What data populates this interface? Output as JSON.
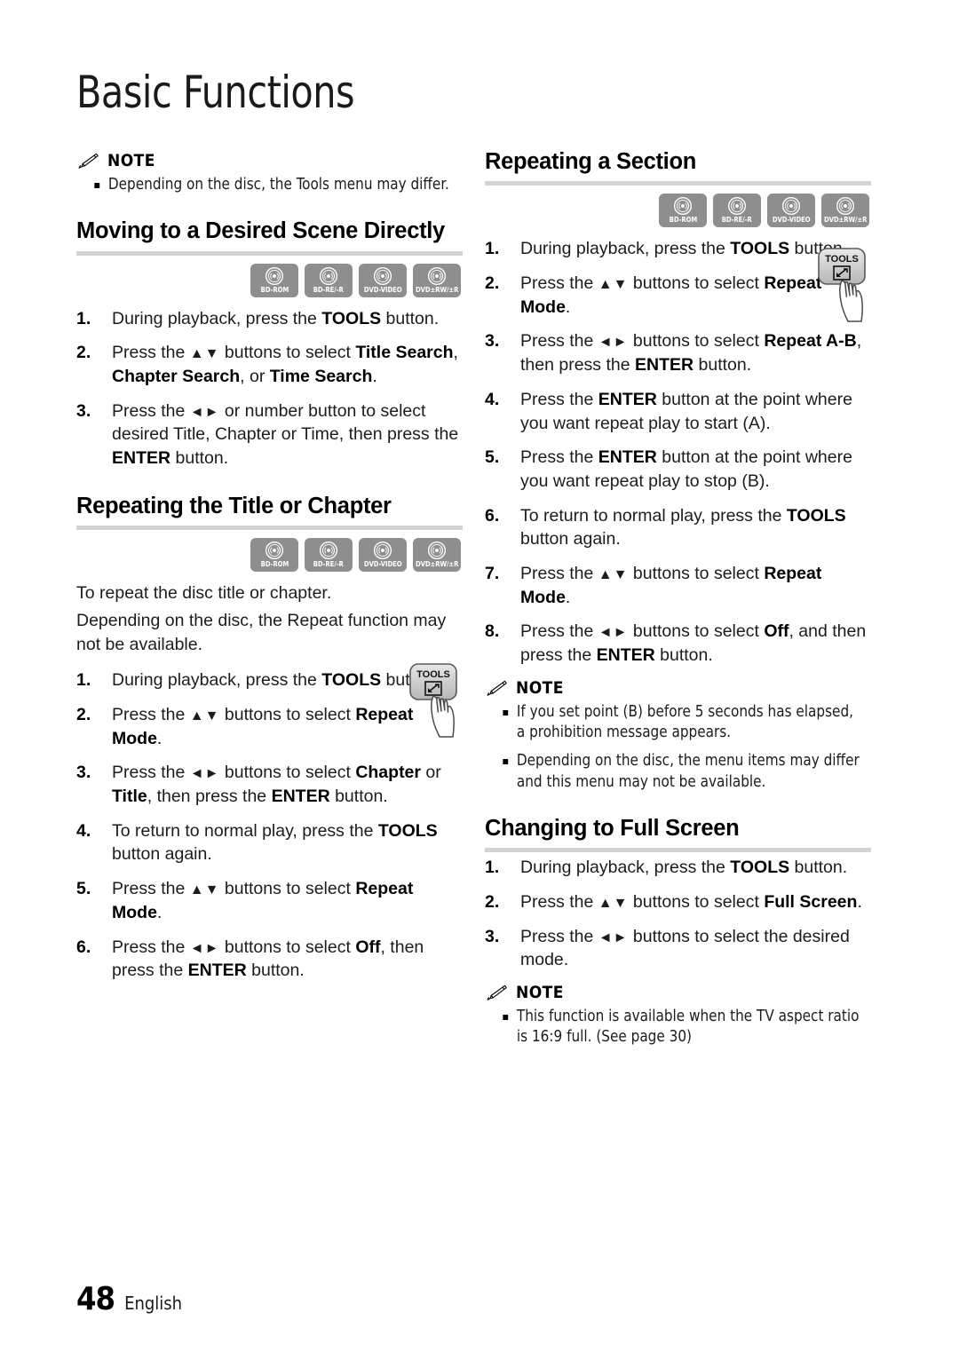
{
  "document": {
    "chapter_title": "Basic Functions",
    "footer": {
      "page_number": "48",
      "language": "English"
    }
  },
  "icons": {
    "note_icon": "pencil-icon",
    "disc_icon": "disc-icon",
    "tools_button_icon": "tools-button-with-hand-icon"
  },
  "colors": {
    "rule_gray": "#d4d4d4",
    "disc_badge_gray": "#8e8e8e",
    "text_black": "#1c1c1c",
    "page_background": "#ffffff"
  },
  "disc_badges": [
    {
      "label": "BD-ROM"
    },
    {
      "label": "BD-RE/-R"
    },
    {
      "label": "DVD-VIDEO"
    },
    {
      "label": "DVD±RW/±R"
    }
  ],
  "left_column": {
    "top_note": {
      "label": "NOTE",
      "items": [
        "Depending on the disc, the Tools menu may differ."
      ]
    },
    "section_moving": {
      "heading": "Moving to a Desired Scene Directly",
      "steps": [
        {
          "num": "1.",
          "html": "During playback, press the <b>TOOLS</b> button."
        },
        {
          "num": "2.",
          "html": "Press the <span class=\"arrows\">▲▼</span> buttons to select <b>Title Search</b>, <b>Chapter Search</b>, or <b>Time Search</b>."
        },
        {
          "num": "3.",
          "html": "Press the <span class=\"arrows\">◄►</span> or number button to select desired Title, Chapter or Time, then press the <b>ENTER</b> button."
        }
      ]
    },
    "section_repeating_title": {
      "heading": "Repeating the Title or Chapter",
      "paragraphs": [
        "To repeat the disc title or chapter.",
        "Depending on the disc, the Repeat function may not be available."
      ],
      "steps": [
        {
          "num": "1.",
          "html": "During playback, press the <b>TOOLS</b> button."
        },
        {
          "num": "2.",
          "html": "Press the <span class=\"arrows\">▲▼</span> buttons to select <b>Repeat Mode</b>."
        },
        {
          "num": "3.",
          "html": "Press the <span class=\"arrows\">◄►</span> buttons to select <b>Chapter</b> or <b>Title</b>, then press the <b>ENTER</b> button."
        },
        {
          "num": "4.",
          "html": "To return to normal play, press the <b>TOOLS</b> button again."
        },
        {
          "num": "5.",
          "html": "Press the <span class=\"arrows\">▲▼</span> buttons to select <b>Repeat Mode</b>."
        },
        {
          "num": "6.",
          "html": "Press the <span class=\"arrows\">◄►</span> buttons to select <b>Off</b>, then press the <b>ENTER</b> button."
        }
      ]
    }
  },
  "right_column": {
    "section_repeating_section": {
      "heading": "Repeating a Section",
      "steps": [
        {
          "num": "1.",
          "html": "During playback, press the <b>TOOLS</b> button."
        },
        {
          "num": "2.",
          "html": "Press the <span class=\"arrows\">▲▼</span> buttons to select <b>Repeat Mode</b>."
        },
        {
          "num": "3.",
          "html": "Press the <span class=\"arrows\">◄►</span> buttons to select <b>Repeat A-B</b>, then press the <b>ENTER</b> button."
        },
        {
          "num": "4.",
          "html": "Press the <b>ENTER</b> button at the point where you want repeat play to start (A)."
        },
        {
          "num": "5.",
          "html": "Press the <b>ENTER</b> button at the point where you want repeat play to stop (B)."
        },
        {
          "num": "6.",
          "html": "To return to normal play, press the <b>TOOLS</b> button again."
        },
        {
          "num": "7.",
          "html": "Press the <span class=\"arrows\">▲▼</span> buttons to select <b>Repeat Mode</b>."
        },
        {
          "num": "8.",
          "html": "Press the <span class=\"arrows\">◄►</span> buttons to select <b>Off</b>, and then press the <b>ENTER</b> button."
        }
      ],
      "note": {
        "label": "NOTE",
        "items": [
          "If you set point (B) before 5 seconds has elapsed, a prohibition message appears.",
          "Depending on the disc, the menu items may differ and this menu may not be available."
        ]
      }
    },
    "section_full_screen": {
      "heading": "Changing to Full Screen",
      "steps": [
        {
          "num": "1.",
          "html": "During playback, press the <b>TOOLS</b> button."
        },
        {
          "num": "2.",
          "html": "Press the <span class=\"arrows\">▲▼</span> buttons to select <b>Full Screen</b>."
        },
        {
          "num": "3.",
          "html": "Press the <span class=\"arrows\">◄►</span> buttons to select the desired mode."
        }
      ],
      "note": {
        "label": "NOTE",
        "items": [
          "This function is available when the TV aspect ratio is 16:9 full. (See page 30)"
        ]
      }
    }
  }
}
